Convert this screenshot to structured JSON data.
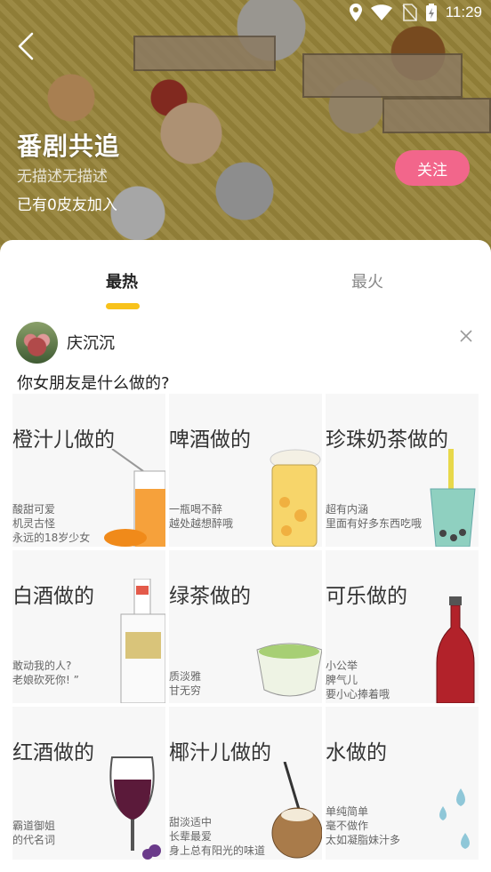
{
  "status_bar": {
    "time": "11:29",
    "icons": [
      "location-icon",
      "wifi-icon",
      "no-sim-icon",
      "battery-charging-icon"
    ]
  },
  "header": {
    "back_icon": "back-arrow-icon",
    "title": "番剧共追",
    "description": "无描述无描述",
    "members": "已有0皮友加入",
    "follow_label": "关注",
    "follow_color": "#f2668b"
  },
  "tabs": [
    {
      "label": "最热",
      "active": true
    },
    {
      "label": "最火",
      "active": false
    }
  ],
  "accent_color": "#f8c21b",
  "post": {
    "username": "庆沉沉",
    "text": "你女朋友是什么做的?",
    "close_icon": "close-icon",
    "images": [
      {
        "title": "橙汁儿做的",
        "lines": [
          "酸甜可爱",
          "机灵古怪",
          "永远的18岁少女"
        ]
      },
      {
        "title": "啤酒做的",
        "lines": [
          "一瓶喝不醉",
          "越处越想醉哦"
        ]
      },
      {
        "title": "珍珠奶茶做的",
        "lines": [
          "超有内涵",
          "里面有好多东西吃哦"
        ]
      },
      {
        "title": "白酒做的",
        "lines": [
          "敢动我的人?",
          "老娘砍死你! ”"
        ]
      },
      {
        "title": "绿茶做的",
        "lines": [
          "质淡雅",
          "甘无穷"
        ]
      },
      {
        "title": "可乐做的",
        "lines": [
          "小公举",
          "脾气儿",
          "要小心捧着哦"
        ]
      },
      {
        "title": "红酒做的",
        "lines": [
          "霸道御姐",
          "的代名词"
        ]
      },
      {
        "title": "椰汁儿做的",
        "lines": [
          "甜淡适中",
          "长辈最爱",
          "身上总有阳光的味道"
        ]
      },
      {
        "title": "水做的",
        "lines": [
          "单纯简单",
          "毫不做作",
          "太如凝脂妹汁多"
        ]
      }
    ]
  }
}
